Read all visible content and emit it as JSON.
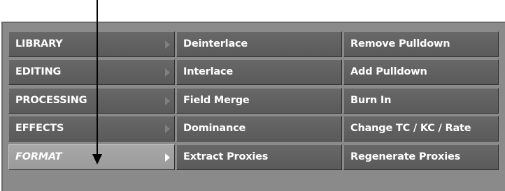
{
  "menu": {
    "categories": [
      {
        "label": "LIBRARY",
        "selected": false
      },
      {
        "label": "EDITING",
        "selected": false
      },
      {
        "label": "PROCESSING",
        "selected": false
      },
      {
        "label": "EFFECTS",
        "selected": false
      },
      {
        "label": "FORMAT",
        "selected": true
      }
    ],
    "submenu_left": [
      "Deinterlace",
      "Interlace",
      "Field Merge",
      "Dominance",
      "Extract Proxies"
    ],
    "submenu_right": [
      "Remove Pulldown",
      "Add Pulldown",
      "Burn In",
      "Change TC / KC / Rate",
      "Regenerate Proxies"
    ]
  },
  "colors": {
    "panel": "#8a8a8a",
    "button": "#606060",
    "button_selected": "#a0a0a0",
    "text": "#ffffff"
  },
  "icons": {
    "submenu_indicator": "triangle-right-icon",
    "callout": "arrow-down-icon"
  }
}
